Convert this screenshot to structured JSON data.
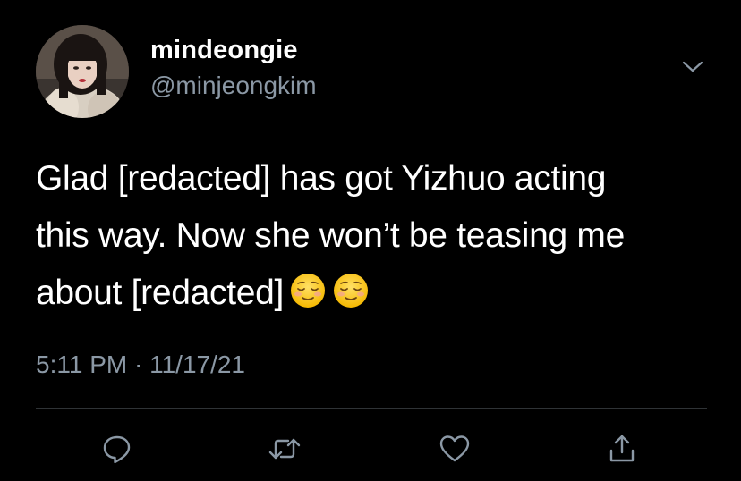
{
  "tweet": {
    "display_name": "mindeongie",
    "handle": "@minjeongkim",
    "body_lines": [
      "Glad [redacted] has got Yizhuo acting",
      "this way. Now she won’t be teasing me",
      "about [redacted]"
    ],
    "emojis": [
      "relieved-face-emoji",
      "relieved-face-emoji"
    ],
    "time": "5:11 PM",
    "separator": "·",
    "date": "11/17/21"
  },
  "actions": [
    {
      "name": "reply",
      "icon": "comment-bubble-icon"
    },
    {
      "name": "retweet",
      "icon": "retweet-arrows-icon"
    },
    {
      "name": "like",
      "icon": "heart-icon"
    },
    {
      "name": "share",
      "icon": "share-upload-icon"
    }
  ],
  "colors": {
    "background": "#000000",
    "primary_text": "#ffffff",
    "secondary_text": "#8b98a5",
    "divider": "#2f3336",
    "icon": "#8b98a5"
  }
}
